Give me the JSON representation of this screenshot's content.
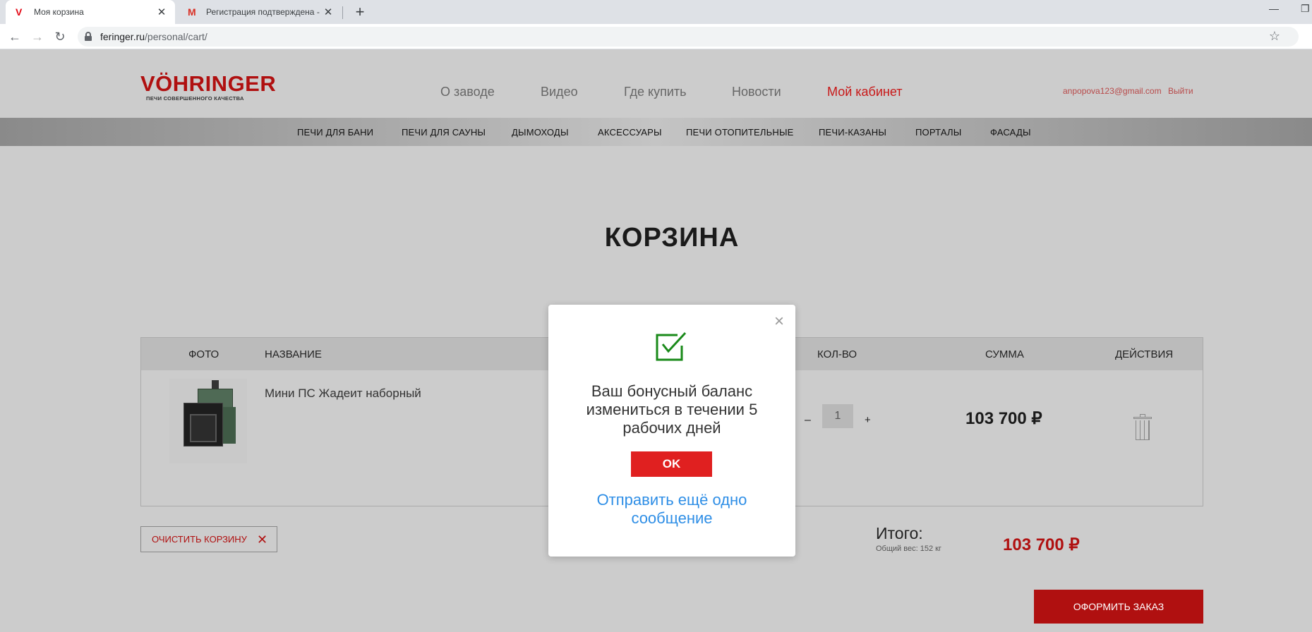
{
  "browser": {
    "tabs": [
      {
        "favicon": "V",
        "title": "Моя корзина",
        "active": true
      },
      {
        "favicon": "M",
        "title": "Регистрация подтверждена - ar",
        "active": false
      }
    ],
    "new_tab": "+",
    "window_minimize": "—",
    "window_restore": "❐",
    "url_domain": "feringer.ru",
    "url_path": "/personal/cart/",
    "nav_back": "←",
    "nav_forward": "→",
    "nav_reload": "↻",
    "bookmark_star": "☆"
  },
  "site": {
    "logo_brand": "VÖHRINGER",
    "logo_tagline": "ПЕЧИ СОВЕРШЕННОГО КАЧЕСТВА",
    "top_nav": [
      "О заводе",
      "Видео",
      "Где купить",
      "Новости",
      "Мой кабинет"
    ],
    "user_email": "anpopova123@gmail.com",
    "logout": "Выйти",
    "categories": [
      "ПЕЧИ ДЛЯ БАНИ",
      "ПЕЧИ ДЛЯ САУНЫ",
      "ДЫМОХОДЫ",
      "АКСЕССУАРЫ",
      "ПЕЧИ ОТОПИТЕЛЬНЫЕ",
      "ПЕЧИ-КАЗАНЫ",
      "ПОРТАЛЫ",
      "ФАСАДЫ"
    ],
    "brand_color": "#b01010"
  },
  "cart": {
    "title": "КОРЗИНА",
    "headers": {
      "photo": "ФОТО",
      "name": "НАЗВАНИЕ",
      "qty": "КОЛ-ВО",
      "sum": "СУММА",
      "actions": "ДЕЙСТВИЯ"
    },
    "items": [
      {
        "name": "Мини ПС Жадеит наборный",
        "qty": "1",
        "sum": "103 700 ₽"
      }
    ],
    "qty_minus": "–",
    "qty_plus": "+",
    "clear_label": "ОЧИСТИТЬ КОРЗИНУ",
    "clear_icon": "✕",
    "total_label": "Итого:",
    "total_weight": "Общий вес: 152 кг",
    "total_sum": "103 700 ₽",
    "checkout_label": "ОФОРМИТЬ ЗАКАЗ"
  },
  "modal": {
    "close": "×",
    "icon": "checkbox-check-icon",
    "message": "Ваш бонусный баланс измениться в течении 5 рабочих дней",
    "ok_label": "OK",
    "send_link": "Отправить ещё одно сообщение",
    "accent": "#e02020",
    "link_color": "#2e8ee6",
    "icon_color": "#1a8a1a"
  }
}
